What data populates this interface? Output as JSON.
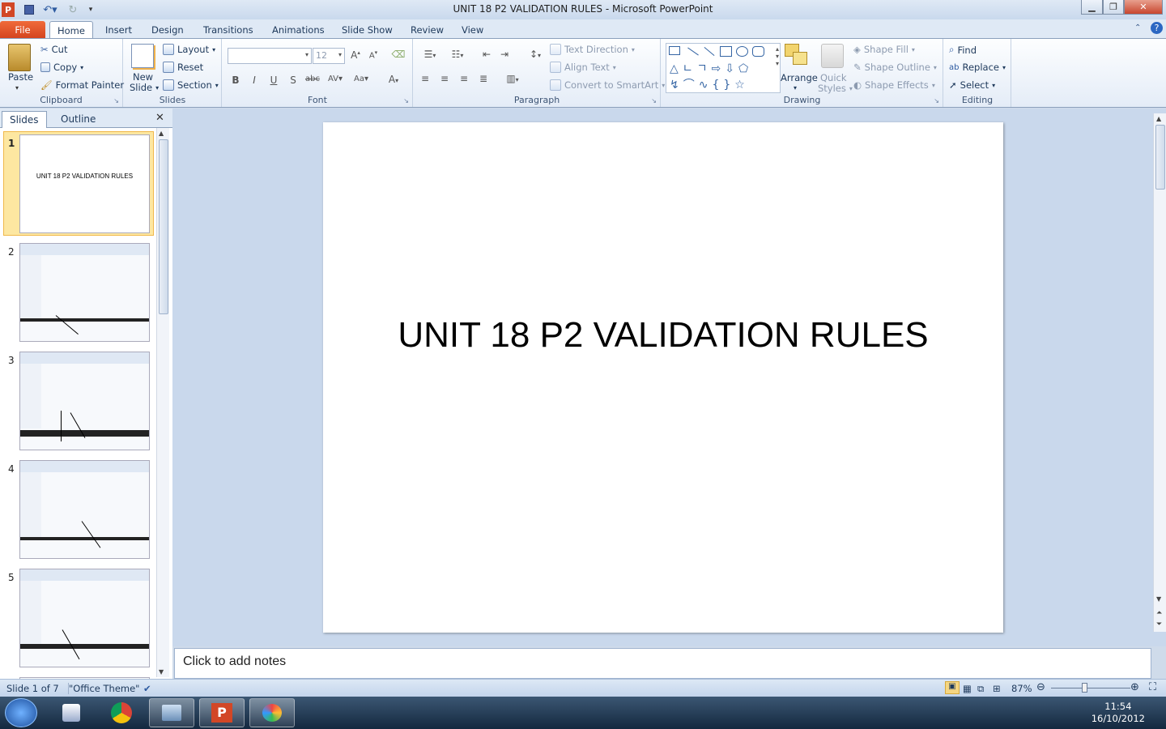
{
  "window": {
    "title": "UNIT 18 P2 VALIDATION RULES  -  Microsoft PowerPoint"
  },
  "tabs": [
    "File",
    "Home",
    "Insert",
    "Design",
    "Transitions",
    "Animations",
    "Slide Show",
    "Review",
    "View"
  ],
  "ribbon": {
    "clipboard": {
      "paste": "Paste",
      "cut": "Cut",
      "copy": "Copy",
      "format_painter": "Format Painter",
      "label": "Clipboard"
    },
    "slides": {
      "new_slide_1": "New",
      "new_slide_2": "Slide",
      "layout": "Layout",
      "reset": "Reset",
      "section": "Section",
      "label": "Slides"
    },
    "font": {
      "font_size": "12",
      "label": "Font"
    },
    "paragraph": {
      "text_direction": "Text Direction",
      "align_text": "Align Text",
      "convert_smartart": "Convert to SmartArt",
      "label": "Paragraph"
    },
    "drawing": {
      "arrange": "Arrange",
      "quick_styles_1": "Quick",
      "quick_styles_2": "Styles",
      "shape_fill": "Shape Fill",
      "shape_outline": "Shape Outline",
      "shape_effects": "Shape Effects",
      "label": "Drawing"
    },
    "editing": {
      "find": "Find",
      "replace": "Replace",
      "select": "Select",
      "label": "Editing"
    }
  },
  "pane": {
    "tab_slides": "Slides",
    "tab_outline": "Outline"
  },
  "thumbnails": [
    {
      "num": "1",
      "title": "UNIT 18 P2 VALIDATION RULES"
    },
    {
      "num": "2"
    },
    {
      "num": "3"
    },
    {
      "num": "4"
    },
    {
      "num": "5"
    }
  ],
  "slide": {
    "title": "UNIT 18 P2 VALIDATION RULES"
  },
  "notes": {
    "placeholder": "Click to add notes"
  },
  "status": {
    "slide_info": "Slide 1 of 7",
    "theme": "\"Office Theme\"",
    "zoom": "87%",
    "zoom_level": 0.87
  },
  "clock": {
    "time": "11:54",
    "date": "16/10/2012"
  },
  "colors": {
    "file_tab": "#d3431d",
    "selected_thumb": "#fde7a1",
    "taskbar": "#14283f"
  }
}
